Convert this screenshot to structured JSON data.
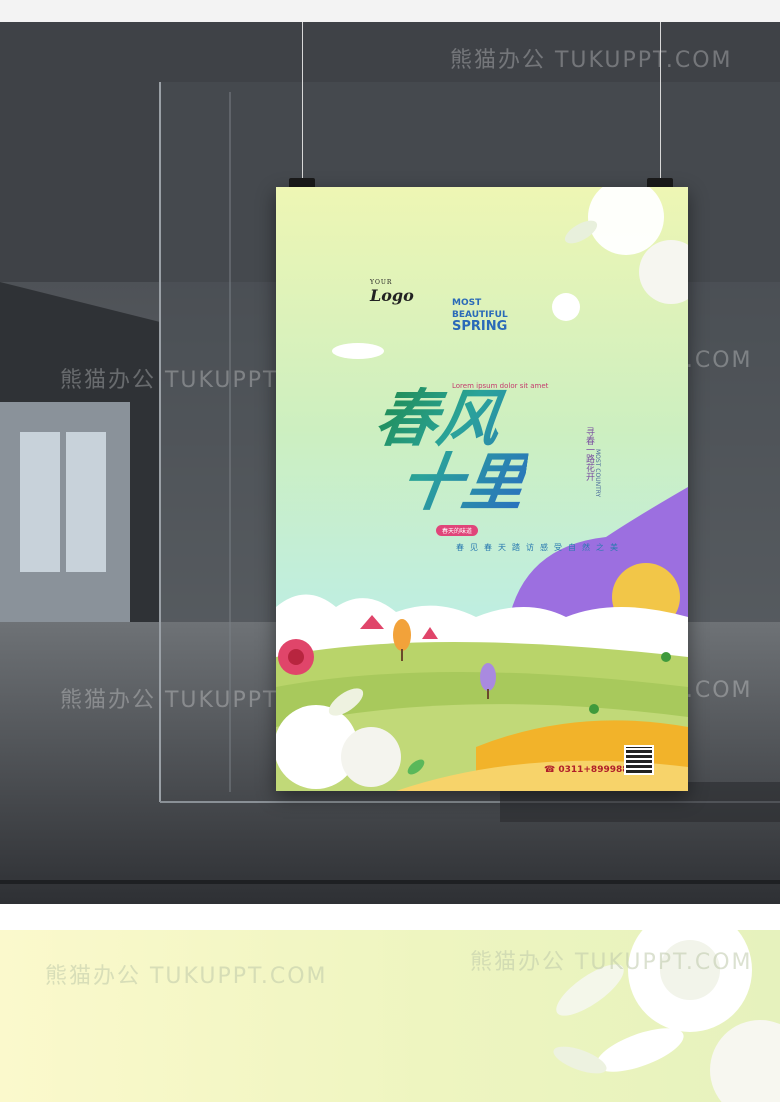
{
  "watermark": {
    "text": "熊猫办公 TUKUPPT.COM"
  },
  "poster": {
    "logo": {
      "small": "YOUR",
      "big": "Logo"
    },
    "english": {
      "line1": "MOST",
      "line2": "BEAUTIFUL",
      "line3": "SPRING"
    },
    "lorem": "Lorem ipsum dolor sit amet",
    "title_row1": "春风",
    "title_row2": "十里",
    "side_text": "寻春一路花开",
    "side_sub": "MOST COUNTRY",
    "tag": "春天的味道",
    "tagline": "春见春天踏访感受自然之美",
    "phone": "0311+89998899"
  },
  "colors": {
    "title_start": "#1f8a4c",
    "title_end": "#2a6fc0",
    "accent_pink": "#e0457a",
    "hill_purple": "#9c6fe0"
  }
}
